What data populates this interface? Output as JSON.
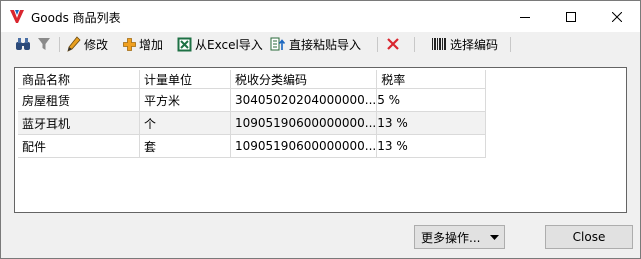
{
  "window": {
    "title": "Goods 商品列表"
  },
  "toolbar": {
    "edit_label": "修改",
    "add_label": "增加",
    "import_excel_label": "从Excel导入",
    "paste_import_label": "直接粘贴导入",
    "select_code_label": "选择编码"
  },
  "grid": {
    "columns": [
      "商品名称",
      "计量单位",
      "税收分类编码",
      "税率"
    ],
    "rows": [
      [
        "房屋租赁",
        "平方米",
        "30405020204000000...",
        "5 %"
      ],
      [
        "蓝牙耳机",
        "个",
        "10905190600000000...",
        "13 %"
      ],
      [
        "配件",
        "套",
        "10905190600000000...",
        "13 %"
      ]
    ]
  },
  "footer": {
    "more_label": "更多操作...",
    "close_label": "Close"
  },
  "colors": {
    "accent_red": "#d9262f",
    "excel_green": "#1e7145",
    "add_orange": "#f0a020"
  }
}
